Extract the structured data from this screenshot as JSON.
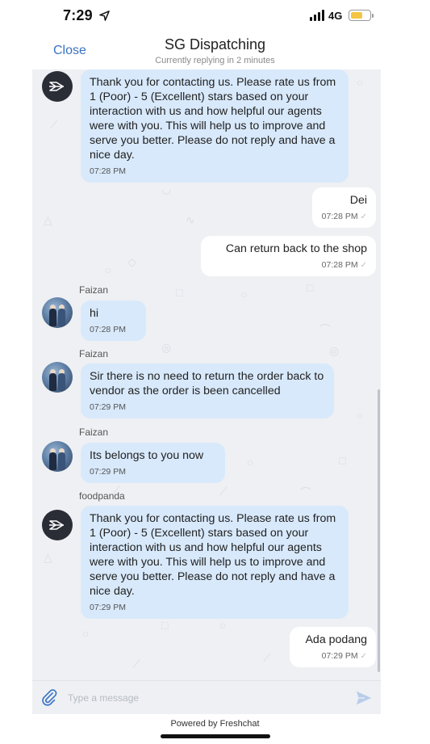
{
  "status_bar": {
    "time": "7:29",
    "network": "4G"
  },
  "colors": {
    "accent": "#3a73c4",
    "incoming_bubble": "#d8e9fb",
    "outgoing_bubble": "#ffffff",
    "chat_bg": "#eef0f3",
    "battery": "#f4c542"
  },
  "icons": {
    "location": "location-arrow-icon",
    "signal": "signal-icon",
    "battery": "battery-icon",
    "attach": "paperclip-icon",
    "send": "send-icon",
    "bot": "foodpanda-bot-icon"
  },
  "header": {
    "close_label": "Close",
    "title": "SG Dispatching",
    "subtitle": "Currently replying in 2 minutes"
  },
  "messages": [
    {
      "direction": "in",
      "sender": "",
      "text": "Thank you for contacting us. Please rate us from 1 (Poor) - 5 (Excellent) stars based on your interaction with us and how helpful our agents were with you. This will help us to improve and serve you better. Please do not reply and have a nice day.",
      "time": "07:28 PM"
    },
    {
      "direction": "out",
      "text": "Dei",
      "time": "07:28 PM"
    },
    {
      "direction": "out",
      "text": "Can return back to the shop",
      "time": "07:28 PM"
    },
    {
      "direction": "in",
      "sender": "Faizan",
      "text": "hi",
      "time": "07:28 PM"
    },
    {
      "direction": "in",
      "sender": "Faizan",
      "text": "Sir there is no need to return the order back to vendor as the order is been cancelled",
      "time": "07:29 PM"
    },
    {
      "direction": "in",
      "sender": "Faizan",
      "text": "Its belongs to you now",
      "time": "07:29 PM"
    },
    {
      "direction": "in",
      "sender": "foodpanda",
      "text": "Thank you for contacting us. Please rate us from 1 (Poor) - 5 (Excellent) stars based on your interaction with us and how helpful our agents were with you. This will help us to improve and serve you better. Please do not reply and have a nice day.",
      "time": "07:29 PM"
    },
    {
      "direction": "out",
      "text": "Ada podang",
      "time": "07:29 PM"
    }
  ],
  "composer": {
    "placeholder": "Type a message"
  },
  "footer": {
    "powered_by": "Powered by Freshchat"
  }
}
